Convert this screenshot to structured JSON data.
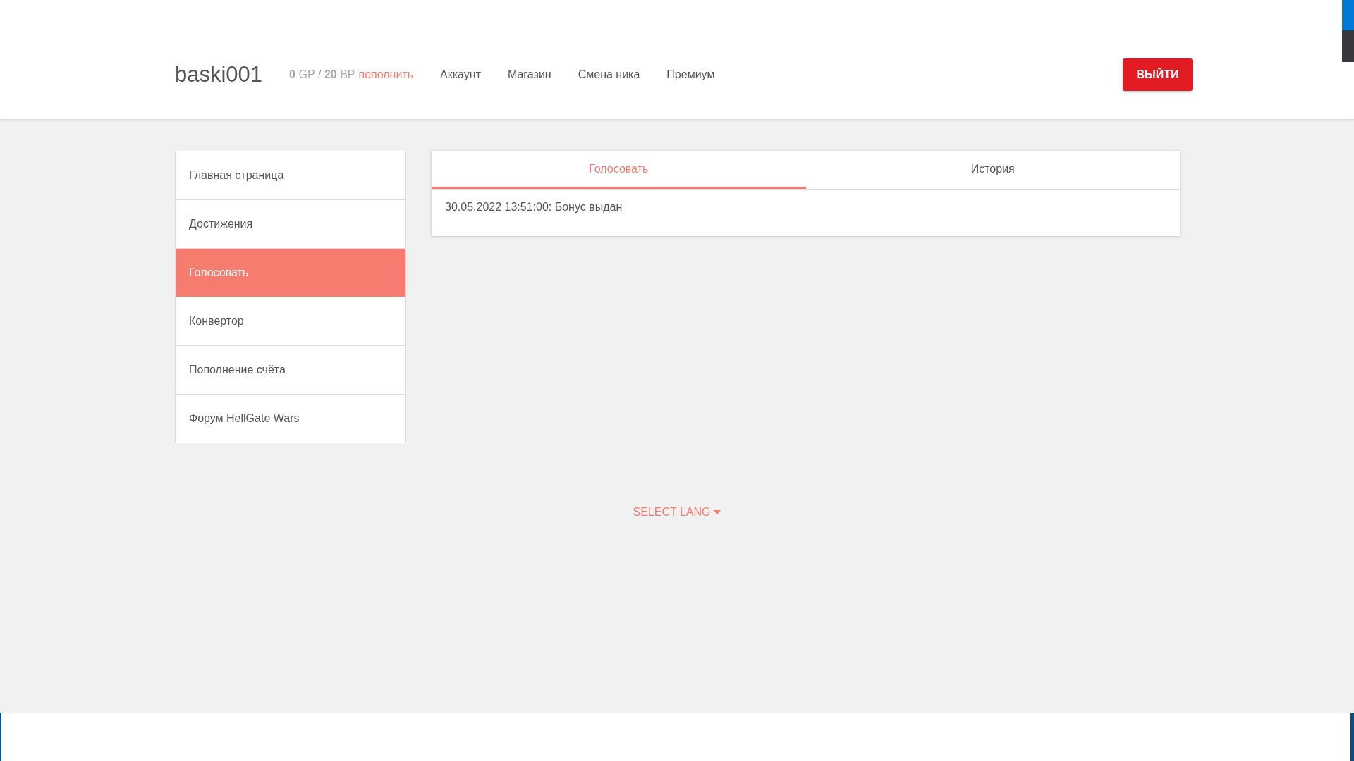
{
  "header": {
    "username": "baski001",
    "balance": [
      {
        "amount": "0",
        "unit": "GP"
      },
      {
        "amount": "20",
        "unit": "BP"
      }
    ],
    "balance_separator": "/",
    "top_up_link": "пополнить",
    "nav": [
      "Аккаунт",
      "Магазин",
      "Смена ника",
      "Премиум"
    ],
    "logout_button": "ВЫЙТИ"
  },
  "sidebar": {
    "items": [
      {
        "label": "Главная страница",
        "selected": false
      },
      {
        "label": "Достижения",
        "selected": false
      },
      {
        "label": "Голосовать",
        "selected": true
      },
      {
        "label": "Конвертор",
        "selected": false
      },
      {
        "label": "Пополнение счёта",
        "selected": false
      },
      {
        "label": "Форум HellGate Wars",
        "selected": false
      }
    ]
  },
  "card": {
    "tabs": [
      {
        "label": "Голосовать",
        "selected": true
      },
      {
        "label": "История",
        "selected": false
      }
    ],
    "entries": [
      "30.05.2022 13:51:00: Бонус выдан"
    ]
  },
  "language_selector": "SELECT LANG"
}
